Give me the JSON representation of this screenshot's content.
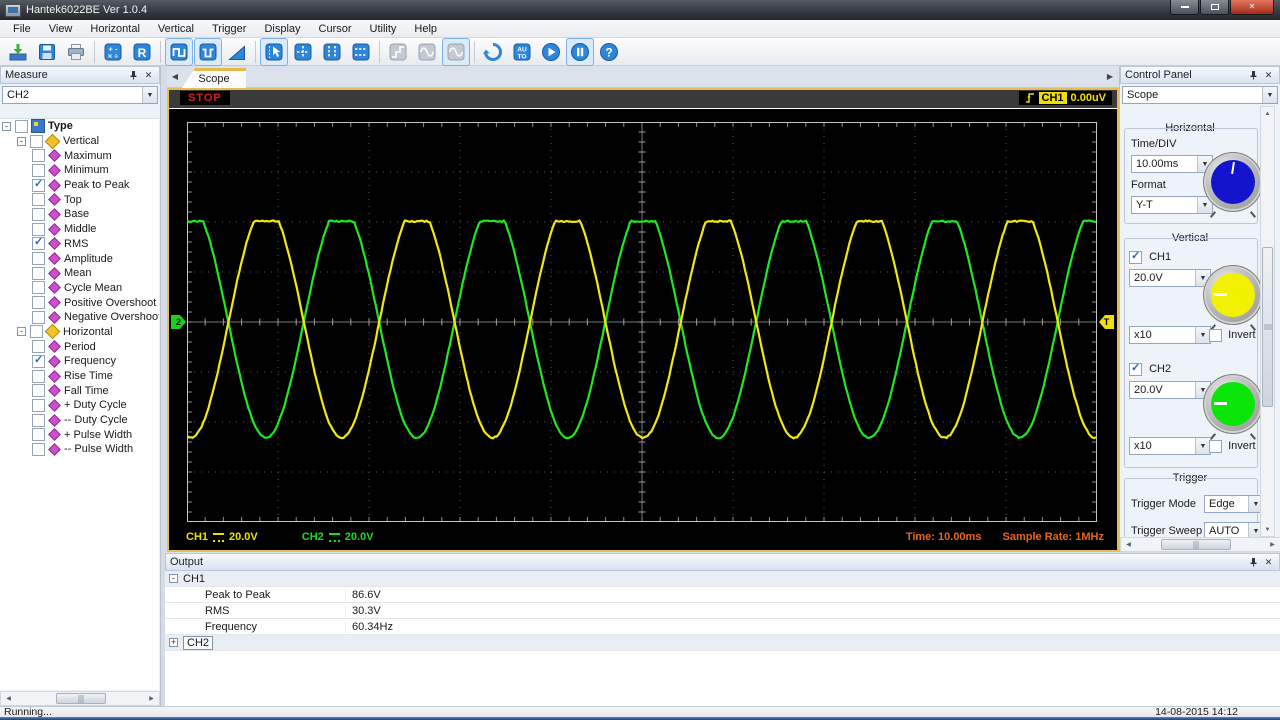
{
  "window": {
    "title": "Hantek6022BE Ver 1.0.4"
  },
  "menu": {
    "items": [
      "File",
      "View",
      "Horizontal",
      "Vertical",
      "Trigger",
      "Display",
      "Cursor",
      "Utility",
      "Help"
    ]
  },
  "toolbar": {
    "buttons": [
      {
        "name": "open-button",
        "icon": "open-icon",
        "state": "normal",
        "sep_after": false
      },
      {
        "name": "save-button",
        "icon": "save-icon",
        "state": "normal",
        "sep_after": false
      },
      {
        "name": "print-button",
        "icon": "print-icon",
        "state": "normal",
        "sep_after": true
      },
      {
        "name": "math-button",
        "icon": "math-icon",
        "state": "normal",
        "sep_after": false
      },
      {
        "name": "reference-button",
        "icon": "reference-icon",
        "state": "normal",
        "sep_after": true
      },
      {
        "name": "ch1-display-button",
        "icon": "square-wave-icon",
        "state": "active",
        "sep_after": false
      },
      {
        "name": "ch2-display-button",
        "icon": "square-wave2-icon",
        "state": "active",
        "sep_after": false
      },
      {
        "name": "ramp-button",
        "icon": "ramp-icon",
        "state": "normal",
        "sep_after": true
      },
      {
        "name": "cursor-select-button",
        "icon": "cursor-arrow-icon",
        "state": "active",
        "sep_after": false
      },
      {
        "name": "cross-cursor-button",
        "icon": "crosshair-icon",
        "state": "normal",
        "sep_after": false
      },
      {
        "name": "vertical-cursor-button",
        "icon": "vertical-lines-icon",
        "state": "normal",
        "sep_after": false
      },
      {
        "name": "horizontal-cursor-button",
        "icon": "horizontal-lines-icon",
        "state": "normal",
        "sep_after": true
      },
      {
        "name": "step-wave-button",
        "icon": "step-wave-icon",
        "state": "disabled",
        "sep_after": false
      },
      {
        "name": "sine-wave-button",
        "icon": "sine-wave-icon",
        "state": "disabled",
        "sep_after": false
      },
      {
        "name": "sine-wave-2-button",
        "icon": "sine-wave-icon",
        "state": "disabled-active",
        "sep_after": true
      },
      {
        "name": "refresh-button",
        "icon": "refresh-icon",
        "state": "normal",
        "sep_after": false
      },
      {
        "name": "auto-set-button",
        "icon": "auto-icon",
        "state": "normal",
        "sep_after": false
      },
      {
        "name": "start-button",
        "icon": "play-icon",
        "state": "normal",
        "sep_after": false
      },
      {
        "name": "pause-button",
        "icon": "pause-icon",
        "state": "active",
        "sep_after": false
      },
      {
        "name": "help-button",
        "icon": "help-icon",
        "state": "normal",
        "sep_after": false
      }
    ]
  },
  "measure_panel": {
    "title": "Measure",
    "channel_selector": "CH2",
    "tree": [
      {
        "label": "Type",
        "level": 0,
        "parent": true,
        "icon": "type-icon",
        "checked": false,
        "bold": true
      },
      {
        "label": "Vertical",
        "level": 1,
        "parent": true,
        "icon": "axis-group-icon",
        "checked": false
      },
      {
        "label": "Maximum",
        "level": 2,
        "checked": false
      },
      {
        "label": "Minimum",
        "level": 2,
        "checked": false
      },
      {
        "label": "Peak to Peak",
        "level": 2,
        "checked": true
      },
      {
        "label": "Top",
        "level": 2,
        "checked": false
      },
      {
        "label": "Base",
        "level": 2,
        "checked": false
      },
      {
        "label": "Middle",
        "level": 2,
        "checked": false
      },
      {
        "label": "RMS",
        "level": 2,
        "checked": true
      },
      {
        "label": "Amplitude",
        "level": 2,
        "checked": false
      },
      {
        "label": "Mean",
        "level": 2,
        "checked": false
      },
      {
        "label": "Cycle Mean",
        "level": 2,
        "checked": false
      },
      {
        "label": "Positive Overshoot",
        "level": 2,
        "checked": false
      },
      {
        "label": "Negative Overshoot",
        "level": 2,
        "checked": false
      },
      {
        "label": "Horizontal",
        "level": 1,
        "parent": true,
        "icon": "axis-group-icon",
        "checked": false
      },
      {
        "label": "Period",
        "level": 2,
        "checked": false
      },
      {
        "label": "Frequency",
        "level": 2,
        "checked": true
      },
      {
        "label": "Rise Time",
        "level": 2,
        "checked": false
      },
      {
        "label": "Fall Time",
        "level": 2,
        "checked": false
      },
      {
        "label": "+ Duty Cycle",
        "level": 2,
        "checked": false
      },
      {
        "label": "-- Duty Cycle",
        "level": 2,
        "checked": false
      },
      {
        "label": "+ Pulse Width",
        "level": 2,
        "checked": false
      },
      {
        "label": "-- Pulse Width",
        "level": 2,
        "checked": false
      }
    ]
  },
  "scope": {
    "tab_label": "Scope",
    "run_status": "STOP",
    "trigger_channel": "CH1",
    "trigger_level": "0.00uV",
    "left_marker": "2",
    "right_marker": "T",
    "ch1_label": "CH1",
    "ch1_scale": "20.0V",
    "ch2_label": "CH2",
    "ch2_scale": "20.0V",
    "time_readout": "Time: 10.00ms",
    "sample_rate_readout": "Sample Rate: 1MHz"
  },
  "control_panel": {
    "title": "Control Panel",
    "mode": "Scope",
    "horizontal": {
      "title": "Horizontal",
      "time_div_label": "Time/DIV",
      "time_div": "10.00ms",
      "format_label": "Format",
      "format": "Y-T",
      "knob_color": "#1414cc"
    },
    "vertical": {
      "title": "Vertical",
      "ch1": {
        "label": "CH1",
        "checked": true,
        "scale": "20.0V",
        "probe": "x10",
        "invert_label": "Invert",
        "invert": false,
        "knob_color": "#f2f200"
      },
      "ch2": {
        "label": "CH2",
        "checked": true,
        "scale": "20.0V",
        "probe": "x10",
        "invert_label": "Invert",
        "invert": false,
        "knob_color": "#0ae60a"
      }
    },
    "trigger": {
      "title": "Trigger",
      "mode_label": "Trigger Mode",
      "mode": "Edge",
      "sweep_label": "Trigger Sweep",
      "sweep": "AUTO"
    }
  },
  "output_panel": {
    "title": "Output",
    "groups": [
      {
        "label": "CH1",
        "expanded": true,
        "rows": [
          {
            "label": "Peak to Peak",
            "value": "86.6V"
          },
          {
            "label": "RMS",
            "value": "30.3V"
          },
          {
            "label": "Frequency",
            "value": "60.34Hz"
          }
        ]
      },
      {
        "label": "CH2",
        "expanded": false,
        "focused": true,
        "rows": []
      }
    ]
  },
  "status_bar": {
    "text": "Running...",
    "datetime": "14-08-2015 14:12"
  },
  "chart_data": {
    "type": "line",
    "title": "Oscilloscope traces CH1/CH2",
    "x_axis": {
      "time_per_div_ms": 10,
      "divisions": 10,
      "total_ms": 100
    },
    "y_axis": {
      "volts_per_div": 20,
      "divisions": 8
    },
    "grid": {
      "background": "#000000",
      "dot_color": "#565656",
      "center_line_color": "#787878"
    },
    "series": [
      {
        "name": "CH1",
        "color": "#f2e80c",
        "waveform": "clipped-sine",
        "amplitude_V": 46.3,
        "clip_top_V": 40.3,
        "peak_to_peak_V": 86.6,
        "rms_V": 30.3,
        "frequency_Hz": 60.34,
        "period_ms": 16.57,
        "first_peak_ms": 8.7
      },
      {
        "name": "CH2",
        "color": "#1ee81e",
        "waveform": "clipped-sine",
        "amplitude_V": 46.3,
        "clip_top_V": 40.3,
        "frequency_Hz": 60.34,
        "period_ms": 16.57,
        "first_peak_ms": 0.4
      }
    ]
  }
}
